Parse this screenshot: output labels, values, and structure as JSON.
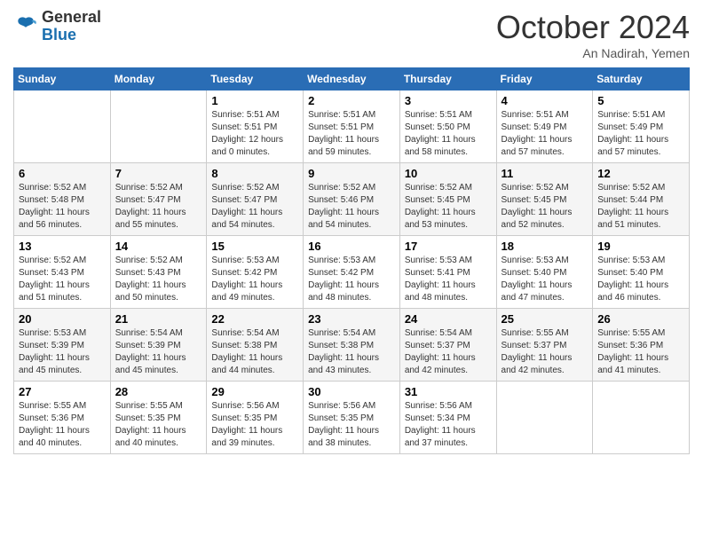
{
  "logo": {
    "line1": "General",
    "line2": "Blue"
  },
  "title": "October 2024",
  "subtitle": "An Nadirah, Yemen",
  "days_header": [
    "Sunday",
    "Monday",
    "Tuesday",
    "Wednesday",
    "Thursday",
    "Friday",
    "Saturday"
  ],
  "weeks": [
    [
      {
        "day": "",
        "info": ""
      },
      {
        "day": "",
        "info": ""
      },
      {
        "day": "1",
        "info": "Sunrise: 5:51 AM\nSunset: 5:51 PM\nDaylight: 12 hours and 0 minutes."
      },
      {
        "day": "2",
        "info": "Sunrise: 5:51 AM\nSunset: 5:51 PM\nDaylight: 11 hours and 59 minutes."
      },
      {
        "day": "3",
        "info": "Sunrise: 5:51 AM\nSunset: 5:50 PM\nDaylight: 11 hours and 58 minutes."
      },
      {
        "day": "4",
        "info": "Sunrise: 5:51 AM\nSunset: 5:49 PM\nDaylight: 11 hours and 57 minutes."
      },
      {
        "day": "5",
        "info": "Sunrise: 5:51 AM\nSunset: 5:49 PM\nDaylight: 11 hours and 57 minutes."
      }
    ],
    [
      {
        "day": "6",
        "info": "Sunrise: 5:52 AM\nSunset: 5:48 PM\nDaylight: 11 hours and 56 minutes."
      },
      {
        "day": "7",
        "info": "Sunrise: 5:52 AM\nSunset: 5:47 PM\nDaylight: 11 hours and 55 minutes."
      },
      {
        "day": "8",
        "info": "Sunrise: 5:52 AM\nSunset: 5:47 PM\nDaylight: 11 hours and 54 minutes."
      },
      {
        "day": "9",
        "info": "Sunrise: 5:52 AM\nSunset: 5:46 PM\nDaylight: 11 hours and 54 minutes."
      },
      {
        "day": "10",
        "info": "Sunrise: 5:52 AM\nSunset: 5:45 PM\nDaylight: 11 hours and 53 minutes."
      },
      {
        "day": "11",
        "info": "Sunrise: 5:52 AM\nSunset: 5:45 PM\nDaylight: 11 hours and 52 minutes."
      },
      {
        "day": "12",
        "info": "Sunrise: 5:52 AM\nSunset: 5:44 PM\nDaylight: 11 hours and 51 minutes."
      }
    ],
    [
      {
        "day": "13",
        "info": "Sunrise: 5:52 AM\nSunset: 5:43 PM\nDaylight: 11 hours and 51 minutes."
      },
      {
        "day": "14",
        "info": "Sunrise: 5:52 AM\nSunset: 5:43 PM\nDaylight: 11 hours and 50 minutes."
      },
      {
        "day": "15",
        "info": "Sunrise: 5:53 AM\nSunset: 5:42 PM\nDaylight: 11 hours and 49 minutes."
      },
      {
        "day": "16",
        "info": "Sunrise: 5:53 AM\nSunset: 5:42 PM\nDaylight: 11 hours and 48 minutes."
      },
      {
        "day": "17",
        "info": "Sunrise: 5:53 AM\nSunset: 5:41 PM\nDaylight: 11 hours and 48 minutes."
      },
      {
        "day": "18",
        "info": "Sunrise: 5:53 AM\nSunset: 5:40 PM\nDaylight: 11 hours and 47 minutes."
      },
      {
        "day": "19",
        "info": "Sunrise: 5:53 AM\nSunset: 5:40 PM\nDaylight: 11 hours and 46 minutes."
      }
    ],
    [
      {
        "day": "20",
        "info": "Sunrise: 5:53 AM\nSunset: 5:39 PM\nDaylight: 11 hours and 45 minutes."
      },
      {
        "day": "21",
        "info": "Sunrise: 5:54 AM\nSunset: 5:39 PM\nDaylight: 11 hours and 45 minutes."
      },
      {
        "day": "22",
        "info": "Sunrise: 5:54 AM\nSunset: 5:38 PM\nDaylight: 11 hours and 44 minutes."
      },
      {
        "day": "23",
        "info": "Sunrise: 5:54 AM\nSunset: 5:38 PM\nDaylight: 11 hours and 43 minutes."
      },
      {
        "day": "24",
        "info": "Sunrise: 5:54 AM\nSunset: 5:37 PM\nDaylight: 11 hours and 42 minutes."
      },
      {
        "day": "25",
        "info": "Sunrise: 5:55 AM\nSunset: 5:37 PM\nDaylight: 11 hours and 42 minutes."
      },
      {
        "day": "26",
        "info": "Sunrise: 5:55 AM\nSunset: 5:36 PM\nDaylight: 11 hours and 41 minutes."
      }
    ],
    [
      {
        "day": "27",
        "info": "Sunrise: 5:55 AM\nSunset: 5:36 PM\nDaylight: 11 hours and 40 minutes."
      },
      {
        "day": "28",
        "info": "Sunrise: 5:55 AM\nSunset: 5:35 PM\nDaylight: 11 hours and 40 minutes."
      },
      {
        "day": "29",
        "info": "Sunrise: 5:56 AM\nSunset: 5:35 PM\nDaylight: 11 hours and 39 minutes."
      },
      {
        "day": "30",
        "info": "Sunrise: 5:56 AM\nSunset: 5:35 PM\nDaylight: 11 hours and 38 minutes."
      },
      {
        "day": "31",
        "info": "Sunrise: 5:56 AM\nSunset: 5:34 PM\nDaylight: 11 hours and 37 minutes."
      },
      {
        "day": "",
        "info": ""
      },
      {
        "day": "",
        "info": ""
      }
    ]
  ]
}
